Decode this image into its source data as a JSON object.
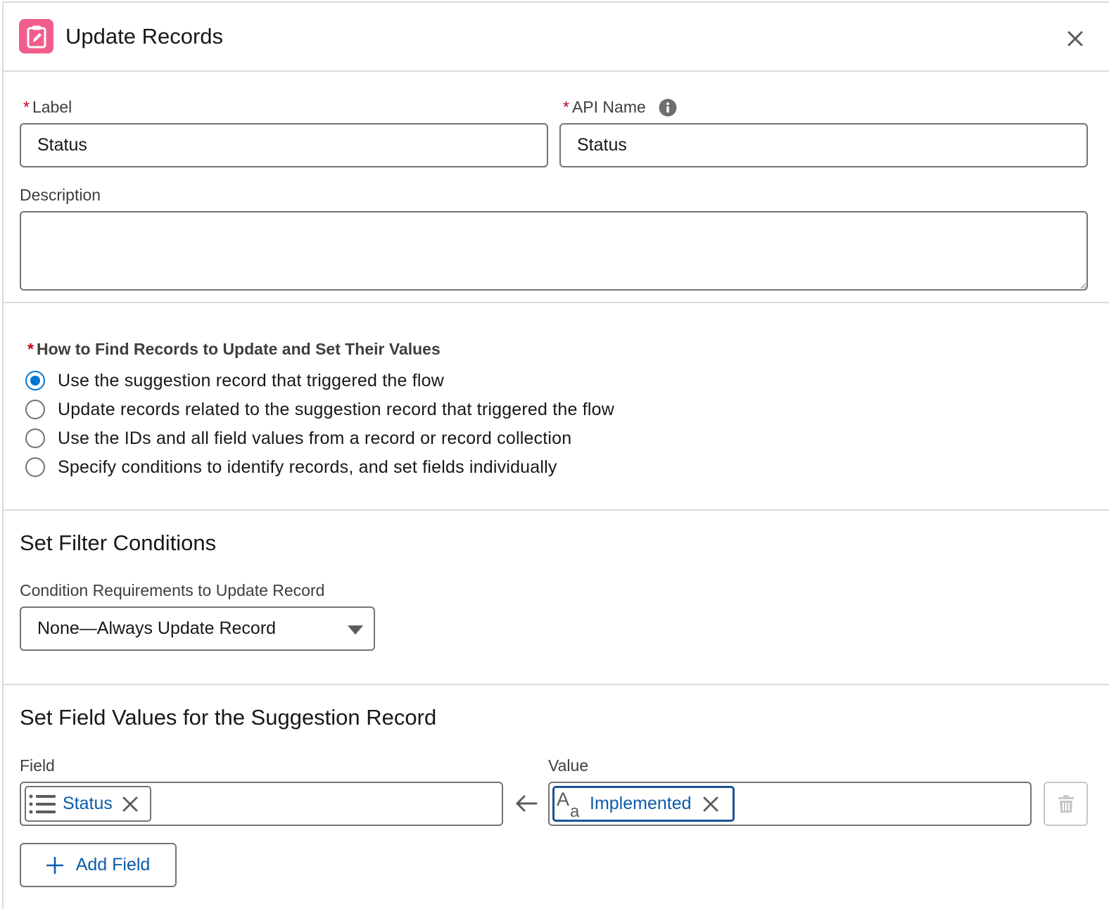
{
  "header": {
    "title": "Update Records",
    "icon": "flow-update-records-icon",
    "icon_color": "#f25e8c"
  },
  "form": {
    "label_field": {
      "required_marker": "*",
      "label": "Label",
      "value": "Status"
    },
    "api_name_field": {
      "required_marker": "*",
      "label": "API Name",
      "value": "Status"
    },
    "description_field": {
      "label": "Description",
      "value": ""
    }
  },
  "find_records": {
    "required_marker": "*",
    "heading": "How to Find Records to Update and Set Their Values",
    "options": [
      {
        "label": "Use the suggestion record that triggered the flow",
        "selected": true
      },
      {
        "label": "Update records related to the suggestion record that triggered the flow",
        "selected": false
      },
      {
        "label": "Use the IDs and all field values from a record or record collection",
        "selected": false
      },
      {
        "label": "Specify conditions to identify records, and set fields individually",
        "selected": false
      }
    ]
  },
  "filter_conditions": {
    "title": "Set Filter Conditions",
    "requirement_label": "Condition Requirements to Update Record",
    "selected_value": "None—Always Update Record"
  },
  "field_values": {
    "title": "Set Field Values for the Suggestion Record",
    "field_header": "Field",
    "value_header": "Value",
    "rows": [
      {
        "field": "Status",
        "value": "Implemented"
      }
    ],
    "add_field_label": "Add Field"
  },
  "colors": {
    "accent": "#0176d3",
    "link": "#0b5cab",
    "required": "#ba0517",
    "border": "#747474",
    "divider": "#dddbda"
  }
}
